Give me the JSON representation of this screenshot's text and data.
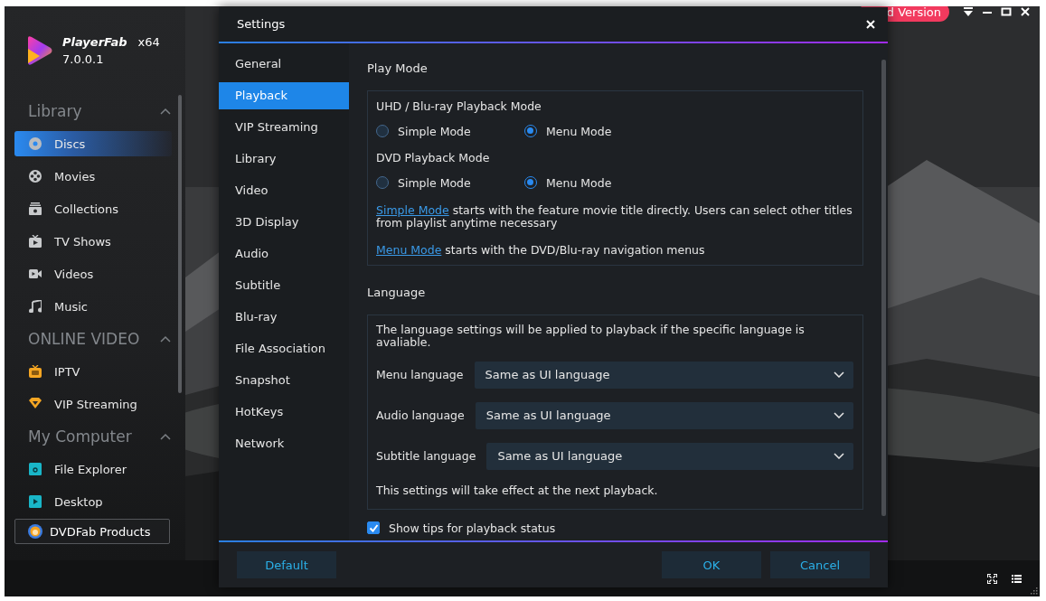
{
  "app": {
    "name": "PlayerFab",
    "arch": "x64",
    "version": "7.0.0.1"
  },
  "sidebar": {
    "sections": [
      {
        "title": "Library",
        "expanded": true,
        "items": [
          {
            "label": "Discs",
            "kind": "disc",
            "selected": true
          },
          {
            "label": "Movies",
            "kind": "reel",
            "selected": false
          },
          {
            "label": "Collections",
            "kind": "collection",
            "selected": false
          },
          {
            "label": "TV Shows",
            "kind": "tv",
            "selected": false
          },
          {
            "label": "Videos",
            "kind": "camera",
            "selected": false
          },
          {
            "label": "Music",
            "kind": "note",
            "selected": false
          }
        ]
      },
      {
        "title": "ONLINE VIDEO",
        "expanded": true,
        "items": [
          {
            "label": "IPTV",
            "kind": "iptv",
            "selected": false
          },
          {
            "label": "VIP Streaming",
            "kind": "diamond",
            "selected": false
          }
        ]
      },
      {
        "title": "My Computer",
        "expanded": true,
        "items": [
          {
            "label": "File Explorer",
            "kind": "folder",
            "selected": false
          },
          {
            "label": "Desktop",
            "kind": "desktop",
            "selected": false
          }
        ]
      }
    ],
    "products_button": "DVDFab Products"
  },
  "main": {
    "upgrade_button": "d Version"
  },
  "settings": {
    "title": "Settings",
    "nav": [
      {
        "label": "General",
        "selected": false
      },
      {
        "label": "Playback",
        "selected": true
      },
      {
        "label": "VIP Streaming",
        "selected": false
      },
      {
        "label": "Library",
        "selected": false
      },
      {
        "label": "Video",
        "selected": false
      },
      {
        "label": "3D Display",
        "selected": false
      },
      {
        "label": "Audio",
        "selected": false
      },
      {
        "label": "Subtitle",
        "selected": false
      },
      {
        "label": "Blu-ray",
        "selected": false
      },
      {
        "label": "File Association",
        "selected": false
      },
      {
        "label": "Snapshot",
        "selected": false
      },
      {
        "label": "HotKeys",
        "selected": false
      },
      {
        "label": "Network",
        "selected": false
      }
    ],
    "play_mode": {
      "title": "Play Mode",
      "groups": [
        {
          "label": "UHD / Blu-ray Playback Mode",
          "options": [
            {
              "label": "Simple Mode",
              "selected": false
            },
            {
              "label": "Menu Mode",
              "selected": true
            }
          ]
        },
        {
          "label": "DVD Playback Mode",
          "options": [
            {
              "label": "Simple Mode",
              "selected": false
            },
            {
              "label": "Menu Mode",
              "selected": true
            }
          ]
        }
      ],
      "notes": [
        {
          "link": "Simple Mode",
          "text": " starts with the feature movie title directly. Users can select other titles from playlist anytime necessary"
        },
        {
          "link": "Menu Mode",
          "text": " starts with the DVD/Blu-ray navigation menus"
        }
      ]
    },
    "language": {
      "title": "Language",
      "intro": "The language settings will be applied to playback if the specific language is avaliable.",
      "dropdowns": [
        {
          "label": "Menu language",
          "value": "Same as UI language"
        },
        {
          "label": "Audio language",
          "value": "Same as UI language"
        },
        {
          "label": "Subtitle language",
          "value": "Same as UI language"
        }
      ],
      "footnote": "This settings will take effect at the next playback."
    },
    "show_tips": {
      "label": "Show tips for playback status",
      "checked": true
    },
    "buttons": [
      {
        "label": "Default",
        "kind": "reset"
      },
      {
        "label": "OK",
        "kind": "confirm"
      },
      {
        "label": "Cancel",
        "kind": "dismiss"
      }
    ]
  }
}
